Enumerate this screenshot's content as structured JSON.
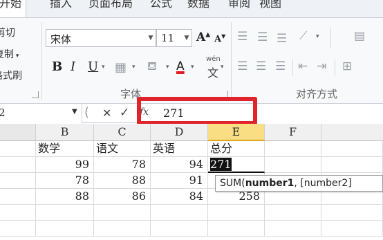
{
  "ribbon_tabs": [
    "开始",
    "插入",
    "页面布局",
    "公式",
    "数据",
    "审阅",
    "视图"
  ],
  "clipboard": {
    "cut": "剪切",
    "copy": "复制",
    "format_painter": "格式刷"
  },
  "font": {
    "name": "宋体",
    "size": "11",
    "group_label": "字体",
    "bold": "B",
    "italic": "I",
    "underline": "U",
    "grow": "A",
    "shrink": "A",
    "font_color": "A",
    "phonetic": "wén"
  },
  "alignment": {
    "group_label": "对齐方式"
  },
  "formula_bar": {
    "name_box": "2",
    "cancel": "✕",
    "enter": "✓",
    "fx": "fx",
    "content": "271"
  },
  "columns": [
    "B",
    "C",
    "D",
    "E",
    "F"
  ],
  "rows": [
    [
      "数学",
      "语文",
      "英语",
      "总分",
      ""
    ],
    [
      "99",
      "78",
      "94",
      "271",
      ""
    ],
    [
      "78",
      "88",
      "91",
      "",
      ""
    ],
    [
      "88",
      "86",
      "84",
      "258",
      ""
    ],
    [
      "",
      "",
      "",
      "",
      ""
    ],
    [
      "",
      "",
      "",
      "",
      ""
    ]
  ],
  "tooltip": {
    "func": "SUM(",
    "arg1": "number1",
    "rest": ", [number2]"
  },
  "colors": {
    "highlight": "#e0242b",
    "selected_col": "#f9de84",
    "font_color_bar": "#e31b23"
  }
}
